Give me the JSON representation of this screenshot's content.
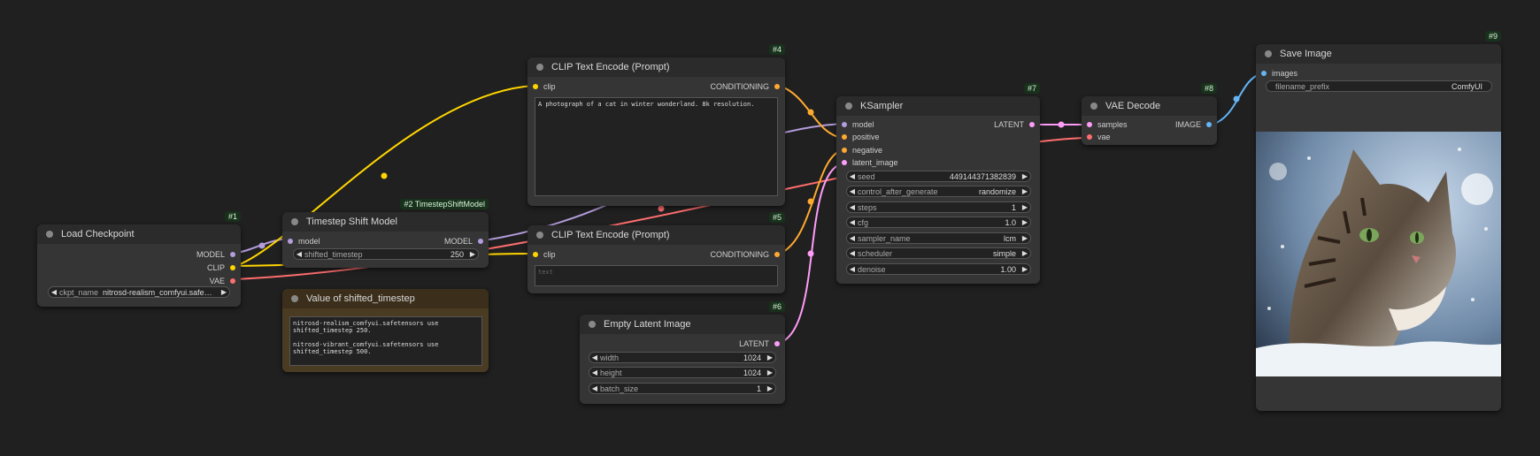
{
  "nodes": {
    "load_checkpoint": {
      "title": "Load Checkpoint",
      "id": "#1",
      "outputs": [
        "MODEL",
        "CLIP",
        "VAE"
      ],
      "ckpt_label": "ckpt_name",
      "ckpt_value": "nitrosd-realism_comfyui.safe…"
    },
    "timestep_shift": {
      "title": "Timestep Shift Model",
      "id": "#2 TimestepShiftModel",
      "input": "model",
      "output": "MODEL",
      "widget_label": "shifted_timestep",
      "widget_value": "250"
    },
    "note": {
      "title": "Value of shifted_timestep",
      "text": "nitrosd-realism_comfyui.safetensors use\nshifted_timestep 250.\n\nnitrosd-vibrant_comfyui.safetensors use\nshifted_timestep 500."
    },
    "clip_text_4": {
      "title": "CLIP Text Encode (Prompt)",
      "id": "#4",
      "input": "clip",
      "output": "CONDITIONING",
      "text": "A photograph of a cat in winter wonderland. 8k resolution."
    },
    "clip_text_5": {
      "title": "CLIP Text Encode (Prompt)",
      "id": "#5",
      "input": "clip",
      "output": "CONDITIONING",
      "placeholder": "text"
    },
    "empty_latent": {
      "title": "Empty Latent Image",
      "id": "#6",
      "output": "LATENT",
      "widgets": [
        {
          "label": "width",
          "value": "1024"
        },
        {
          "label": "height",
          "value": "1024"
        },
        {
          "label": "batch_size",
          "value": "1"
        }
      ]
    },
    "ksampler": {
      "title": "KSampler",
      "id": "#7",
      "inputs": [
        "model",
        "positive",
        "negative",
        "latent_image"
      ],
      "output": "LATENT",
      "widgets": [
        {
          "label": "seed",
          "value": "449144371382839"
        },
        {
          "label": "control_after_generate",
          "value": "randomize"
        },
        {
          "label": "steps",
          "value": "1"
        },
        {
          "label": "cfg",
          "value": "1.0"
        },
        {
          "label": "sampler_name",
          "value": "lcm"
        },
        {
          "label": "scheduler",
          "value": "simple"
        },
        {
          "label": "denoise",
          "value": "1.00"
        }
      ]
    },
    "vae_decode": {
      "title": "VAE Decode",
      "id": "#8",
      "inputs": [
        "samples",
        "vae"
      ],
      "output": "IMAGE"
    },
    "save_image": {
      "title": "Save Image",
      "id": "#9",
      "input": "images",
      "widget_label": "filename_prefix",
      "widget_value": "ComfyUI"
    }
  },
  "colors": {
    "model": "#b39ddb",
    "clip": "#ffd500",
    "vae": "#ff6e6e",
    "conditioning": "#ffa931",
    "latent": "#ff9cf9",
    "image": "#64b5f6",
    "note_bg": "#4a3c22"
  }
}
